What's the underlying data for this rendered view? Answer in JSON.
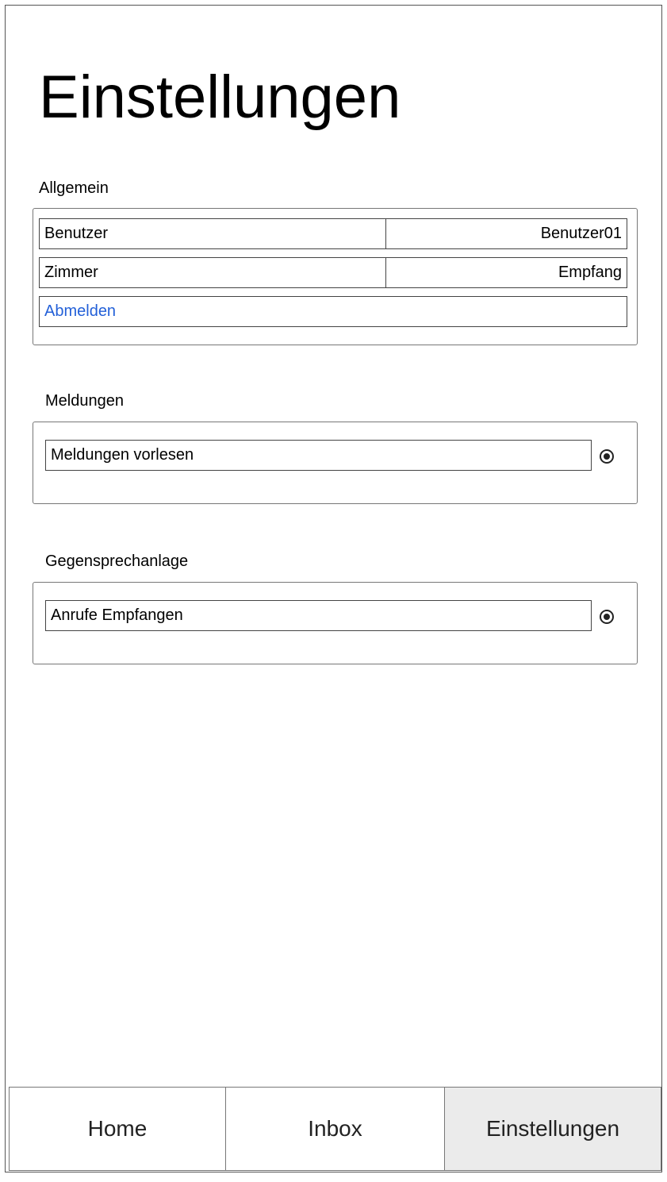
{
  "page": {
    "title": "Einstellungen"
  },
  "sections": {
    "general": {
      "label": "Allgemein",
      "rows": [
        {
          "label": "Benutzer",
          "value": "Benutzer01"
        },
        {
          "label": "Zimmer",
          "value": "Empfang"
        }
      ],
      "logout_label": "Abmelden"
    },
    "notifications": {
      "label": "Meldungen",
      "toggle_label": "Meldungen vorlesen",
      "toggle_selected": true
    },
    "intercom": {
      "label": "Gegensprechanlage",
      "toggle_label": "Anrufe Empfangen",
      "toggle_selected": true
    }
  },
  "tabs": [
    {
      "label": "Home",
      "active": false
    },
    {
      "label": "Inbox",
      "active": false
    },
    {
      "label": "Einstellungen",
      "active": true
    }
  ],
  "colors": {
    "link": "#2360d8",
    "active_tab_bg": "#ebebeb"
  }
}
